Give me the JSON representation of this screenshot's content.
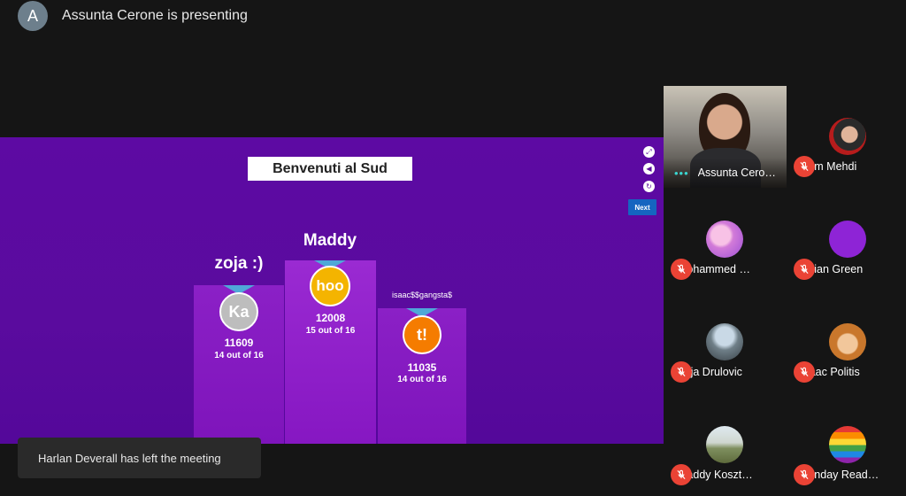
{
  "presenter": {
    "avatar_initial": "A",
    "text": "Assunta Cerone is presenting"
  },
  "slide": {
    "title": "Benvenuti al Sud",
    "next_label": "Next",
    "podium": [
      {
        "name": "zoja :)",
        "medal_text": "Ka",
        "medal_color": "#bdbdbd",
        "score": "11609",
        "correct": "14 out of 16"
      },
      {
        "name": "Maddy",
        "medal_text": "hoo",
        "medal_color": "#f4b400",
        "score": "12008",
        "correct": "15 out of 16"
      },
      {
        "name": "isaac$$gangsta$",
        "medal_text": "t!",
        "medal_color": "#f57c00",
        "score": "11035",
        "correct": "14 out of 16"
      }
    ]
  },
  "toast": {
    "text": "Harlan Deverall has left the meeting"
  },
  "participants": [
    {
      "name": "Assunta Cero…",
      "type": "camera"
    },
    {
      "name": "Sam Mehdi",
      "muted": true
    },
    {
      "name": "Mohammed …",
      "muted": true
    },
    {
      "name": "Lillian Green",
      "muted": true,
      "avatar_color": "#8e24d6"
    },
    {
      "name": "Zoja Drulovic",
      "muted": true
    },
    {
      "name": "Isaac Politis",
      "muted": true
    },
    {
      "name": "Maddy Koszt…",
      "muted": true
    },
    {
      "name": "Sunday Read…",
      "muted": true
    }
  ],
  "colors": {
    "mic_off": "#ea4335",
    "speaking_dots": "#3ad6d0",
    "stage": "#5a0b9e",
    "next_button": "#1565c0"
  }
}
